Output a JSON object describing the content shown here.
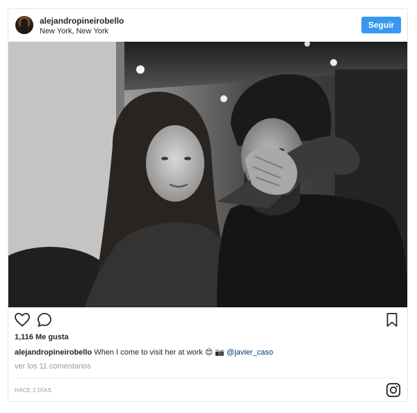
{
  "post": {
    "header": {
      "username": "alejandropineirobello",
      "location": "New York, New York",
      "follow_label": "Seguir"
    },
    "photo": {
      "description_icon": "couple-photo"
    },
    "actions": {
      "like_icon": "heart-icon",
      "comment_icon": "comment-icon",
      "save_icon": "bookmark-icon"
    },
    "likes_text": "1,116 Me gusta",
    "caption": {
      "username": "alejandropineirobello",
      "text": "When I come to visit her at work 😍 📷",
      "mention": "@javier_caso"
    },
    "view_comments": "ver los 11 comentarios",
    "timestamp": "HACE 2 DÍAS",
    "logo_icon": "instagram-icon"
  },
  "colors": {
    "accent": "#3897f0",
    "text": "#262626",
    "muted": "#999999",
    "mention": "#003569"
  }
}
